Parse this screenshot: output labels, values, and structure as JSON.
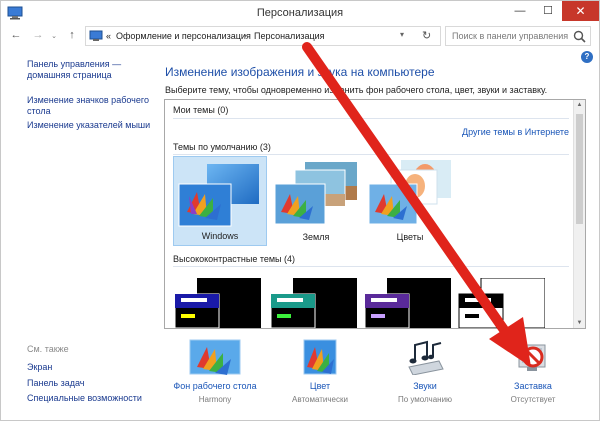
{
  "window": {
    "title": "Персонализация",
    "controls": {
      "minimize": "—",
      "maximize": "☐",
      "close": "✕"
    }
  },
  "nav": {
    "back": "←",
    "forward": "→",
    "recent": "⌄",
    "up": "↑",
    "address": {
      "prefix": "«",
      "crumbs": [
        "Оформление и персонализация",
        "Персонализация"
      ],
      "separator": "›"
    },
    "search": {
      "placeholder": "Поиск в панели управления"
    }
  },
  "help_label": "?",
  "sidebar": {
    "links": [
      "Панель управления — домашняя страница",
      "Изменение значков рабочего стола",
      "Изменение указателей мыши"
    ],
    "see_also_title": "См. также",
    "see_also": [
      "Экран",
      "Панель задач",
      "Специальные возможности"
    ]
  },
  "main": {
    "title": "Изменение изображения и звука на компьютере",
    "description": "Выберите тему, чтобы одновременно изменить фон рабочего стола, цвет, звуки и заставку.",
    "my_themes": "Мои темы (0)",
    "online_link": "Другие темы в Интернете",
    "default_themes": "Темы по умолчанию (3)",
    "themes": [
      {
        "name": "Windows",
        "selected": true
      },
      {
        "name": "Земля",
        "selected": false
      },
      {
        "name": "Цветы",
        "selected": false
      }
    ],
    "high_contrast": "Высококонтрастные темы (4)"
  },
  "bottom": [
    {
      "label": "Фон рабочего стола",
      "sub": "Harmony",
      "icon": "desktop-background-icon"
    },
    {
      "label": "Цвет",
      "sub": "Автоматически",
      "icon": "color-icon"
    },
    {
      "label": "Звуки",
      "sub": "По умолчанию",
      "icon": "sounds-icon"
    },
    {
      "label": "Заставка",
      "sub": "Отсутствует",
      "icon": "screensaver-icon"
    }
  ],
  "colors": {
    "link": "#1a56b8",
    "title_blue": "#1e4fa8",
    "close_red": "#c7372a",
    "selection": "#cce4f7",
    "arrow_red": "#e0241b"
  }
}
